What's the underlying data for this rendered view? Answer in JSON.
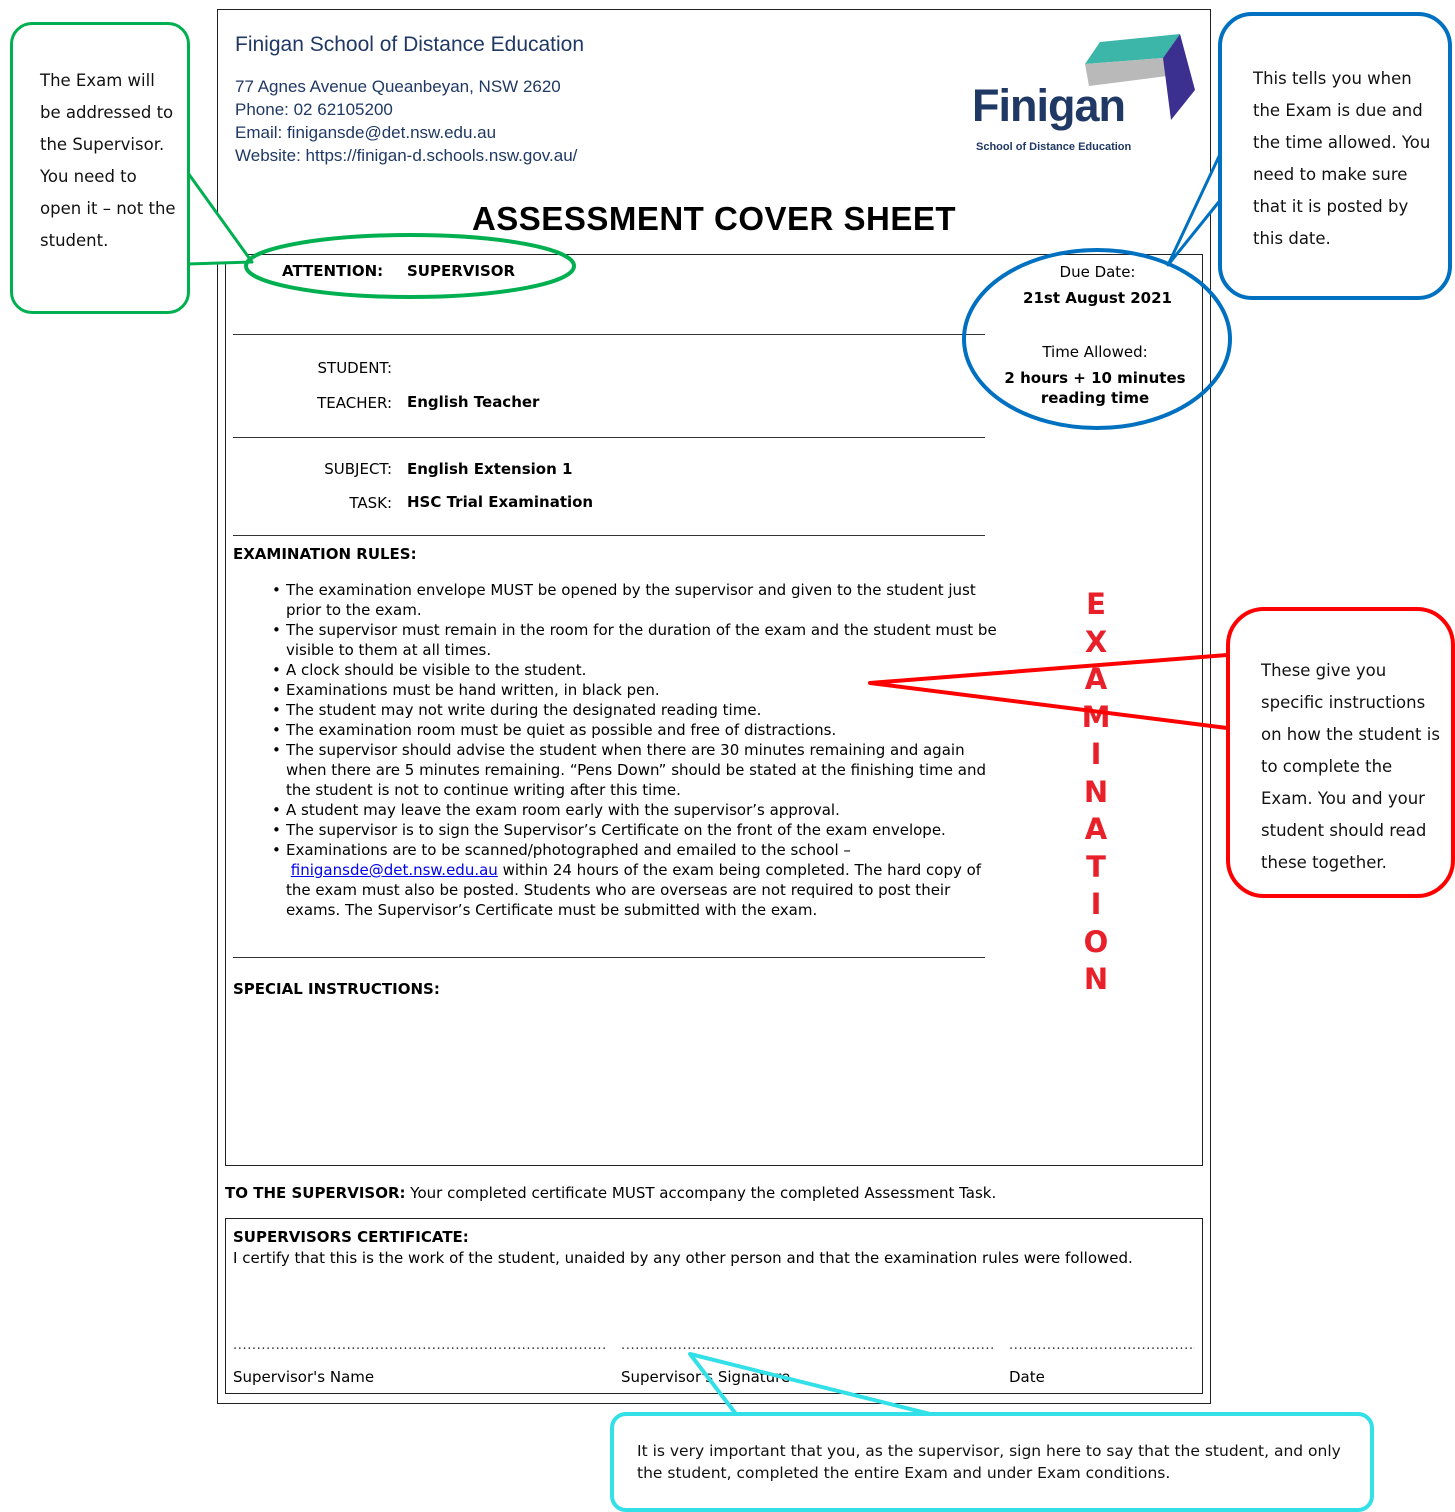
{
  "header": {
    "school_name": "Finigan School of Distance Education",
    "address": "77 Agnes Avenue Queanbeyan, NSW 2620",
    "phone": "Phone: 02 62105200",
    "email": "Email: finigansde@det.nsw.edu.au",
    "website": "Website: https://finigan-d.schools.nsw.gov.au/",
    "logo_word": "Finigan",
    "logo_sub": "School of Distance Education"
  },
  "title": "ASSESSMENT COVER SHEET",
  "attention": {
    "label": "ATTENTION:",
    "value": "SUPERVISOR"
  },
  "due": {
    "due_label": "Due Date:",
    "due_value": "21st August 2021",
    "time_label": "Time Allowed:",
    "time_value_1": "2 hours + 10 minutes",
    "time_value_2": "reading time"
  },
  "student": {
    "label": "STUDENT:",
    "value": ""
  },
  "teacher": {
    "label": "TEACHER:",
    "value": "English Teacher"
  },
  "subject": {
    "label": "SUBJECT:",
    "value": "English Extension 1"
  },
  "task": {
    "label": "TASK:",
    "value": "HSC Trial Examination"
  },
  "rules_heading": "EXAMINATION RULES:",
  "rules": [
    "The examination envelope MUST be opened by the supervisor and given to the student just prior to the exam.",
    "The supervisor must remain in the room for the duration of the exam and the student must be visible to them at all times.",
    "A clock should be visible to the student.",
    "Examinations must be hand written, in black pen.",
    "The student may not write during the designated reading time.",
    "The examination room must be quiet as possible and free of distractions.",
    "The supervisor should advise the student when there are 30 minutes remaining and again when there are 5 minutes remaining. “Pens Down” should be stated at the finishing time and the student is not to continue writing after this time.",
    "A student may leave the exam room early with the supervisor’s approval.",
    "The supervisor is to sign the Supervisor’s Certificate on the front of the exam envelope."
  ],
  "rule_last": {
    "before": "Examinations are to be scanned/photographed and emailed to the school –",
    "email": "finigansde@det.nsw.edu.au",
    "after": " within 24 hours of the exam being completed. The hard copy of the exam must also be posted. Students who are overseas are not required to post their exams.  The Supervisor’s Certificate must be submitted with the exam."
  },
  "vertical_word": [
    "E",
    "X",
    "A",
    "M",
    "I",
    "N",
    "A",
    "T",
    "I",
    "O",
    "N"
  ],
  "special_heading": "SPECIAL INSTRUCTIONS:",
  "to_supervisor": {
    "label": "TO THE SUPERVISOR:",
    "text": " Your completed certificate MUST accompany the completed Assessment Task."
  },
  "certificate": {
    "heading": "SUPERVISORS CERTIFICATE:",
    "text": "I certify that this is the work of the student, unaided by any other person and that the examination rules were followed.",
    "name_label": "Supervisor's Name",
    "signature_label": "Supervisor's Signature",
    "date_label": "Date"
  },
  "callouts": {
    "green": "The Exam will be addressed to the Supervisor. You need to open it – not the student.",
    "blue": "This tells you when the Exam is due and the time allowed. You need to make sure that it is posted by this date.",
    "red": "These give you specific instructions on how the student is to complete the Exam. You and your student should read these together.",
    "cyan": "It is very  important that you, as the supervisor, sign here to say that the student, and only the student, completed the entire Exam and under Exam conditions."
  },
  "colors": {
    "green": "#00b050",
    "blue": "#0070c0",
    "red": "#ff0000",
    "cyan": "#33e0e8",
    "header_text": "#1f3864",
    "logo_teal": "#3bb6a8",
    "logo_purple": "#3b2f8f",
    "logo_grey": "#b0b0b0"
  }
}
